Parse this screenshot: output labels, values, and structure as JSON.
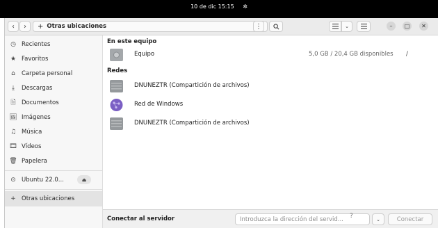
{
  "topbar": {
    "clock": "10 de dic  15:15",
    "notif_icon": "notification-icon"
  },
  "header": {
    "back_icon": "chevron-left-icon",
    "forward_icon": "chevron-right-icon",
    "path_plus": "+",
    "path_label": "Otras ubicaciones",
    "path_menu": "⋮",
    "search_icon": "search-icon",
    "view_list_icon": "list-view-icon",
    "view_dropdown_icon": "chevron-down-icon",
    "menu_icon": "hamburger-menu-icon",
    "minimize": "–",
    "maximize": "□",
    "close": "✕"
  },
  "sidebar": {
    "items": [
      {
        "label": "Recientes",
        "icon": "◷"
      },
      {
        "label": "Favoritos",
        "icon": "★"
      },
      {
        "label": "Carpeta personal",
        "icon": "⌂"
      },
      {
        "label": "Descargas",
        "icon": "⤓"
      },
      {
        "label": "Documentos",
        "icon": "🗎"
      },
      {
        "label": "Imágenes",
        "icon": "🖼"
      },
      {
        "label": "Música",
        "icon": "♫"
      },
      {
        "label": "Vídeos",
        "icon": "🎞"
      },
      {
        "label": "Papelera",
        "icon": "🗑"
      }
    ],
    "drive": {
      "label": "Ubuntu 22.0...",
      "icon": "⊙",
      "eject": "⏏"
    },
    "other": {
      "label": "Otras ubicaciones",
      "icon": "+"
    }
  },
  "main": {
    "section_device": "En este equipo",
    "device": {
      "label": "Equipo",
      "space": "5,0 GB / 20,4 GB disponibles",
      "path": "/"
    },
    "section_networks": "Redes",
    "networks": [
      {
        "label": "DNUNEZTR (Compartición de archivos)"
      },
      {
        "label": "Red de Windows"
      },
      {
        "label": "DNUNEZTR (Compartición de archivos)"
      }
    ]
  },
  "footer": {
    "label": "Conectar al servidor",
    "placeholder": "Introduzca la dirección del servid...",
    "help": "?",
    "dropdown": "⌄",
    "connect": "Conectar"
  }
}
